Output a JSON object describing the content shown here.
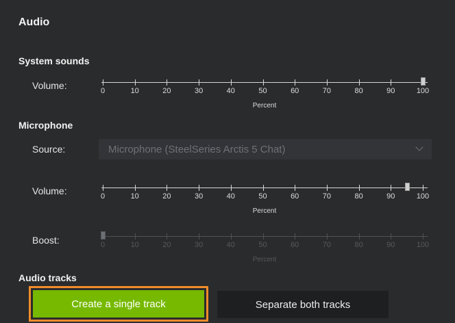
{
  "section_title": "Audio",
  "system_sounds": {
    "heading": "System sounds",
    "volume_label": "Volume:",
    "volume_value": 100
  },
  "microphone": {
    "heading": "Microphone",
    "source_label": "Source:",
    "source_value": "Microphone (SteelSeries Arctis 5 Chat)",
    "volume_label": "Volume:",
    "volume_value": 95,
    "boost_label": "Boost:",
    "boost_value": 0
  },
  "slider_scale": {
    "ticks": [
      "0",
      "10",
      "20",
      "30",
      "40",
      "50",
      "60",
      "70",
      "80",
      "90",
      "100"
    ],
    "unit": "Percent"
  },
  "audio_tracks": {
    "heading": "Audio tracks",
    "single_track_label": "Create a single track",
    "separate_tracks_label": "Separate both tracks"
  },
  "colors": {
    "accent_green": "#76b900",
    "highlight_orange": "#f08c2a",
    "background": "#2a2b2d"
  },
  "icons": {
    "dropdown": "chevron-down-icon"
  }
}
